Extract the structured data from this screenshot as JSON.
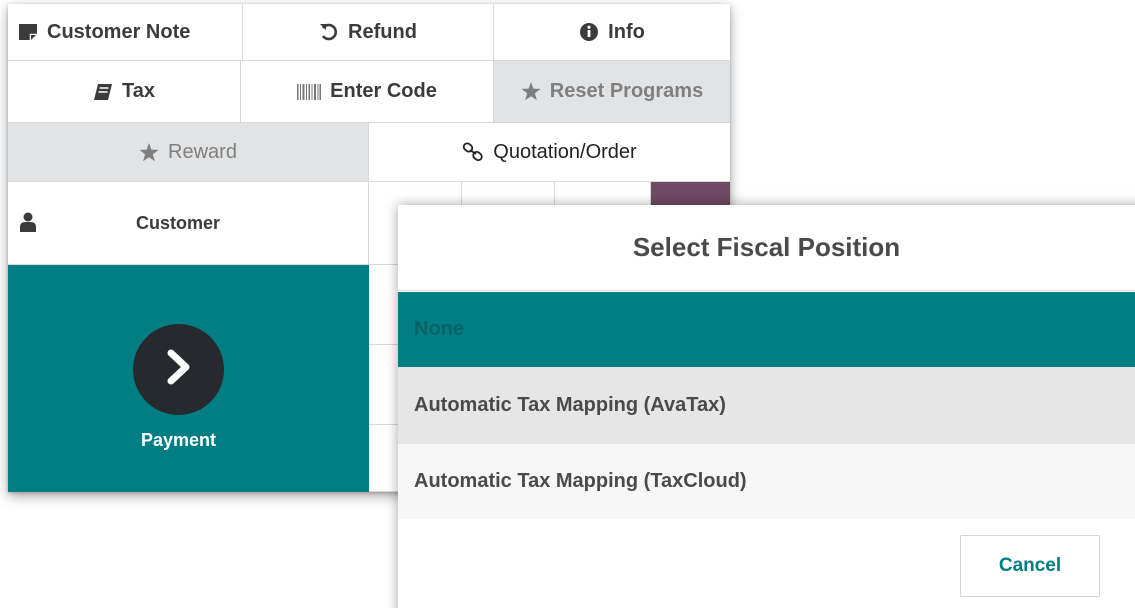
{
  "controls": {
    "customer_note": {
      "label": "Customer Note",
      "icon": "note-icon"
    },
    "refund": {
      "label": "Refund",
      "icon": "undo-icon"
    },
    "info": {
      "label": "Info",
      "icon": "info-circle-icon"
    },
    "tax": {
      "label": "Tax",
      "icon": "book-icon"
    },
    "enter_code": {
      "label": "Enter Code",
      "icon": "barcode-icon"
    },
    "reset_programs": {
      "label": "Reset Programs",
      "icon": "star-icon",
      "disabled": true
    },
    "reward": {
      "label": "Reward",
      "icon": "star-icon",
      "disabled": true
    },
    "quotation_order": {
      "label": "Quotation/Order",
      "icon": "link-icon"
    }
  },
  "customer": {
    "label": "Customer",
    "icon": "user-icon"
  },
  "payment": {
    "label": "Payment",
    "icon": "chevron-right-icon"
  },
  "modal": {
    "title": "Select Fiscal Position",
    "options": [
      {
        "label": "None",
        "state": "selected"
      },
      {
        "label": "Automatic Tax Mapping (AvaTax)",
        "state": "hover"
      },
      {
        "label": "Automatic Tax Mapping (TaxCloud)",
        "state": "normal"
      }
    ],
    "cancel_label": "Cancel"
  },
  "colors": {
    "teal": "#017e84",
    "dark": "#262a2e",
    "plum": "#6f4a63",
    "disabled_bg": "#e2e3e5"
  }
}
